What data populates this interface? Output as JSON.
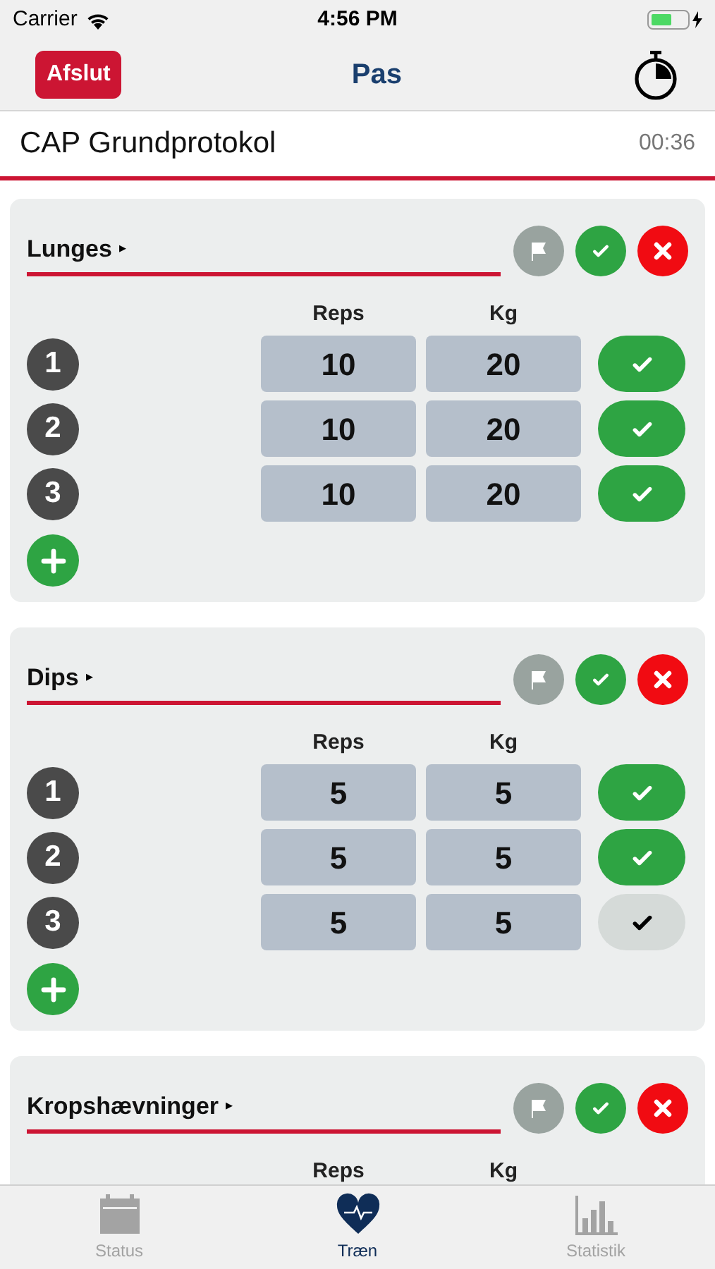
{
  "status_bar": {
    "carrier": "Carrier",
    "time": "4:56 PM"
  },
  "nav": {
    "left_button": "Afslut",
    "title": "Pas"
  },
  "session": {
    "name": "CAP Grundprotokol",
    "elapsed": "00:36"
  },
  "exercises": [
    {
      "name": "Lunges",
      "caret": "▸",
      "columns": [
        "Reps",
        "Kg"
      ],
      "sets": [
        {
          "number": "1",
          "reps": "10",
          "kg": "20",
          "done": true
        },
        {
          "number": "2",
          "reps": "10",
          "kg": "20",
          "done": true
        },
        {
          "number": "3",
          "reps": "10",
          "kg": "20",
          "done": true
        }
      ]
    },
    {
      "name": "Dips",
      "caret": "▸",
      "columns": [
        "Reps",
        "Kg"
      ],
      "sets": [
        {
          "number": "1",
          "reps": "5",
          "kg": "5",
          "done": true
        },
        {
          "number": "2",
          "reps": "5",
          "kg": "5",
          "done": true
        },
        {
          "number": "3",
          "reps": "5",
          "kg": "5",
          "done": false
        }
      ]
    },
    {
      "name": "Kropshævninger",
      "caret": "▸",
      "columns": [
        "Reps",
        "Kg"
      ]
    }
  ],
  "tabs": [
    {
      "label": "Status",
      "selected": false
    },
    {
      "label": "Træn",
      "selected": true
    },
    {
      "label": "Statistik",
      "selected": false
    }
  ]
}
